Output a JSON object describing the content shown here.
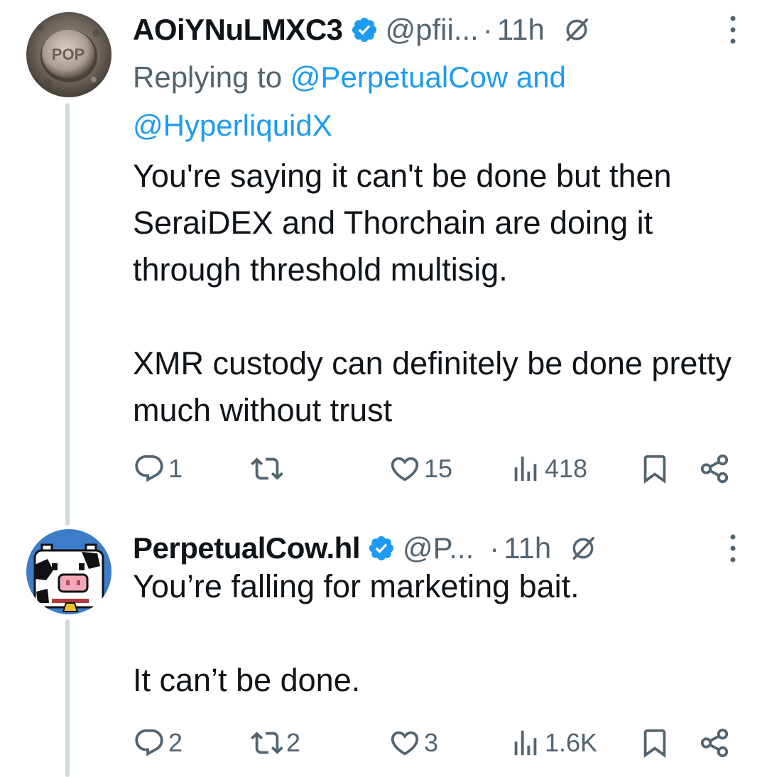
{
  "tweets": [
    {
      "display_name": "AOiYNuLMXC3",
      "handle": "@pfii...",
      "separator": "·",
      "time": "11h",
      "reply_to": {
        "prefix": "Replying to",
        "mention_1": "@PerpetualCow",
        "conjunction": "and",
        "mention_2": "@HyperliquidX"
      },
      "text": "You're saying it can't be done but then SeraiDEX and Thorchain are doing it through threshold multisig.\n\nXMR custody can definitely be done pretty much without trust",
      "reply_count": "1",
      "repost_count": "",
      "like_count": "15",
      "view_count": "418"
    },
    {
      "display_name": "PerpetualCow.hl",
      "handle": "@P...",
      "separator": "·",
      "time": "11h",
      "text": "You’re falling for marketing bait.\n\nIt can’t be done.",
      "reply_count": "2",
      "repost_count": "2",
      "like_count": "3",
      "view_count": "1.6K"
    }
  ],
  "colors": {
    "text": "#0f1419",
    "secondary": "#536471",
    "accent": "#1d9bf0",
    "thread_line": "#cfd9de"
  },
  "icons": {
    "verified": "verified-badge-icon",
    "grok": "grok-icon",
    "more": "more-vertical-icon",
    "reply": "reply-icon",
    "repost": "repost-icon",
    "like": "heart-icon",
    "views": "views-bar-chart-icon",
    "bookmark": "bookmark-icon",
    "share": "share-icon"
  }
}
